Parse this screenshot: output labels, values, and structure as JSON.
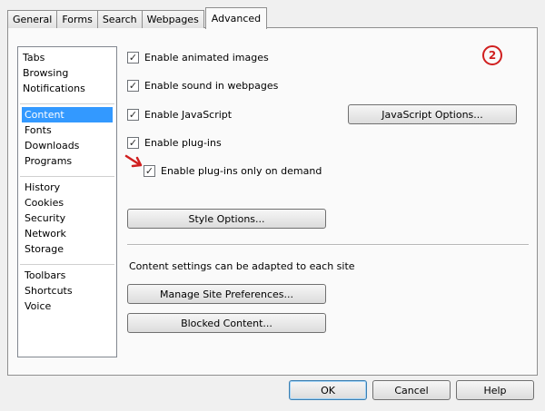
{
  "tabs": [
    "General",
    "Forms",
    "Search",
    "Webpages",
    "Advanced"
  ],
  "sidebar": {
    "groups": [
      [
        "Tabs",
        "Browsing",
        "Notifications"
      ],
      [
        "Content",
        "Fonts",
        "Downloads",
        "Programs"
      ],
      [
        "History",
        "Cookies",
        "Security",
        "Network",
        "Storage"
      ],
      [
        "Toolbars",
        "Shortcuts",
        "Voice"
      ]
    ],
    "selected": "Content"
  },
  "options": {
    "animated_images": {
      "label": "Enable animated images",
      "checked": true
    },
    "sound": {
      "label": "Enable sound in webpages",
      "checked": true
    },
    "javascript": {
      "label": "Enable JavaScript",
      "checked": true
    },
    "plugins": {
      "label": "Enable plug-ins",
      "checked": true
    },
    "plugins_on_demand": {
      "label": "Enable plug-ins only on demand",
      "checked": true
    }
  },
  "buttons": {
    "javascript_options": "JavaScript Options...",
    "style_options": "Style Options...",
    "manage_site_prefs": "Manage Site Preferences...",
    "blocked_content": "Blocked Content...",
    "ok": "OK",
    "cancel": "Cancel",
    "help": "Help"
  },
  "content_settings_text": "Content settings can be adapted to each site",
  "annotation_badge": "2",
  "checkmark": "✓",
  "colors": {
    "selection": "#3399ff",
    "annotation": "#d01f1f"
  }
}
